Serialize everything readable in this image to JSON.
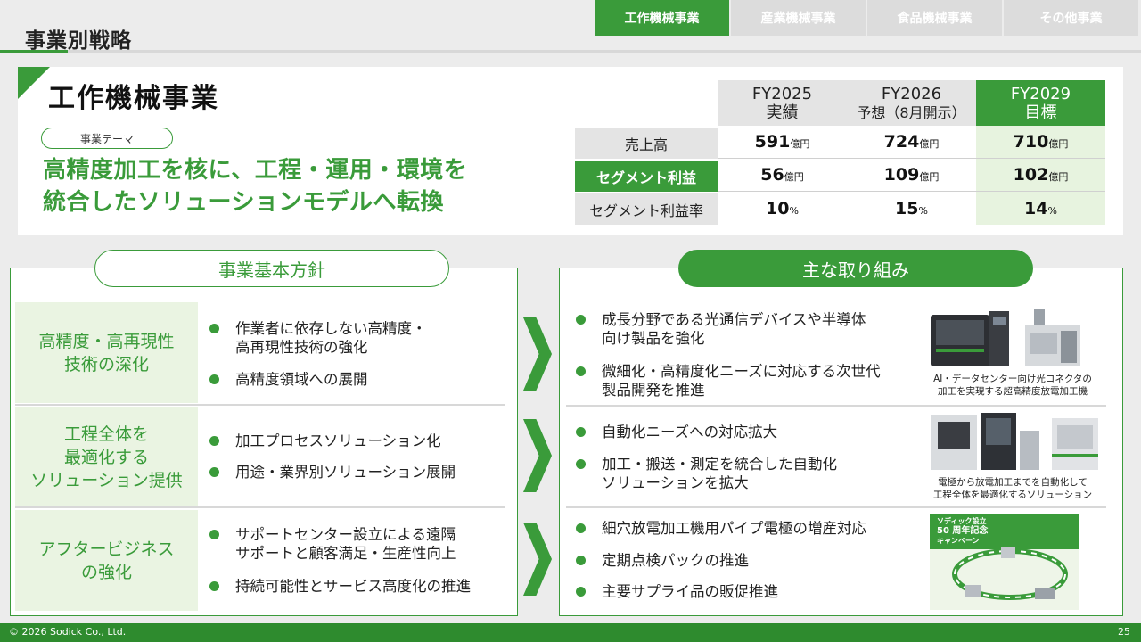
{
  "page": {
    "title": "事業別戦略",
    "page_number": "25",
    "copyright": "© 2026 Sodick Co., Ltd."
  },
  "tabs": [
    "工作機械事業",
    "産業機械事業",
    "食品機械事業",
    "その他事業"
  ],
  "active_tab": "工作機械事業",
  "segment": {
    "title": "工作機械事業",
    "theme_label": "事業テーマ",
    "theme_line1": "高精度加工を核に、工程・運用・環境を",
    "theme_line2": "統合したソリューションモデルへ転換"
  },
  "kpi": {
    "columns": [
      {
        "line1": "FY2025",
        "line2": "実績"
      },
      {
        "line1": "FY2026",
        "line2": "予想（8月開示）"
      },
      {
        "line1": "FY2029",
        "line2": "目標"
      }
    ],
    "rows": [
      {
        "label": "売上高",
        "values": [
          {
            "num": "591",
            "unit": "億円"
          },
          {
            "num": "724",
            "unit": "億円"
          },
          {
            "num": "710",
            "unit": "億円"
          }
        ]
      },
      {
        "label": "セグメント利益",
        "values": [
          {
            "num": "56",
            "unit": "億円"
          },
          {
            "num": "109",
            "unit": "億円"
          },
          {
            "num": "102",
            "unit": "億円"
          }
        ]
      },
      {
        "label": "セグメント利益率",
        "values": [
          {
            "num": "10",
            "unit": "%"
          },
          {
            "num": "15",
            "unit": "%"
          },
          {
            "num": "14",
            "unit": "%"
          }
        ]
      }
    ]
  },
  "policy": {
    "header": "事業基本方針",
    "items": [
      {
        "line1": "高精度・高再現性",
        "line2": "技術の深化",
        "line3": "",
        "b1a": "作業者に依存しない高精度・",
        "b1b": "高再現性技術の強化",
        "b2a": "高精度領域への展開",
        "b2b": ""
      },
      {
        "line1": "工程全体を",
        "line2": "最適化する",
        "line3": "ソリューション提供",
        "b1a": "加工プロセスソリューション化",
        "b1b": "",
        "b2a": "用途・業界別ソリューション展開",
        "b2b": ""
      },
      {
        "line1": "アフタービジネス",
        "line2": "の強化",
        "line3": "",
        "b1a": "サポートセンター設立による遠隔",
        "b1b": "サポートと顧客満足・生産性向上",
        "b2a": "持続可能性とサービス高度化の推進",
        "b2b": ""
      }
    ]
  },
  "initiatives": {
    "header": "主な取り組み",
    "g1": {
      "b1a": "成長分野である光通信デバイスや半導体",
      "b1b": "向け製品を強化",
      "b2a": "微細化・高精度化ニーズに対応する次世代",
      "b2b": "製品開発を推進",
      "cap1": "AI・データセンター向け光コネクタの",
      "cap2": "加工を実現する超高精度放電加工機"
    },
    "g2": {
      "b1a": "自動化ニーズへの対応拡大",
      "b2a": "加工・搬送・測定を統合した自動化",
      "b2b": "ソリューションを拡大",
      "cap1": "電極から放電加工までを自動化して",
      "cap2": "工程全体を最適化するソリューション"
    },
    "g3": {
      "b1": "細穴放電加工機用パイプ電極の増産対応",
      "b2": "定期点検パックの推進",
      "b3": "主要サプライ品の販促推進",
      "poster1": "ソディック設立",
      "poster2": "50 周年記念",
      "poster3": "キャンペーン"
    }
  },
  "colors": {
    "accent": "#3a9b3a",
    "accent_light": "#eaf4e2",
    "gray": "#e4e4e4"
  }
}
